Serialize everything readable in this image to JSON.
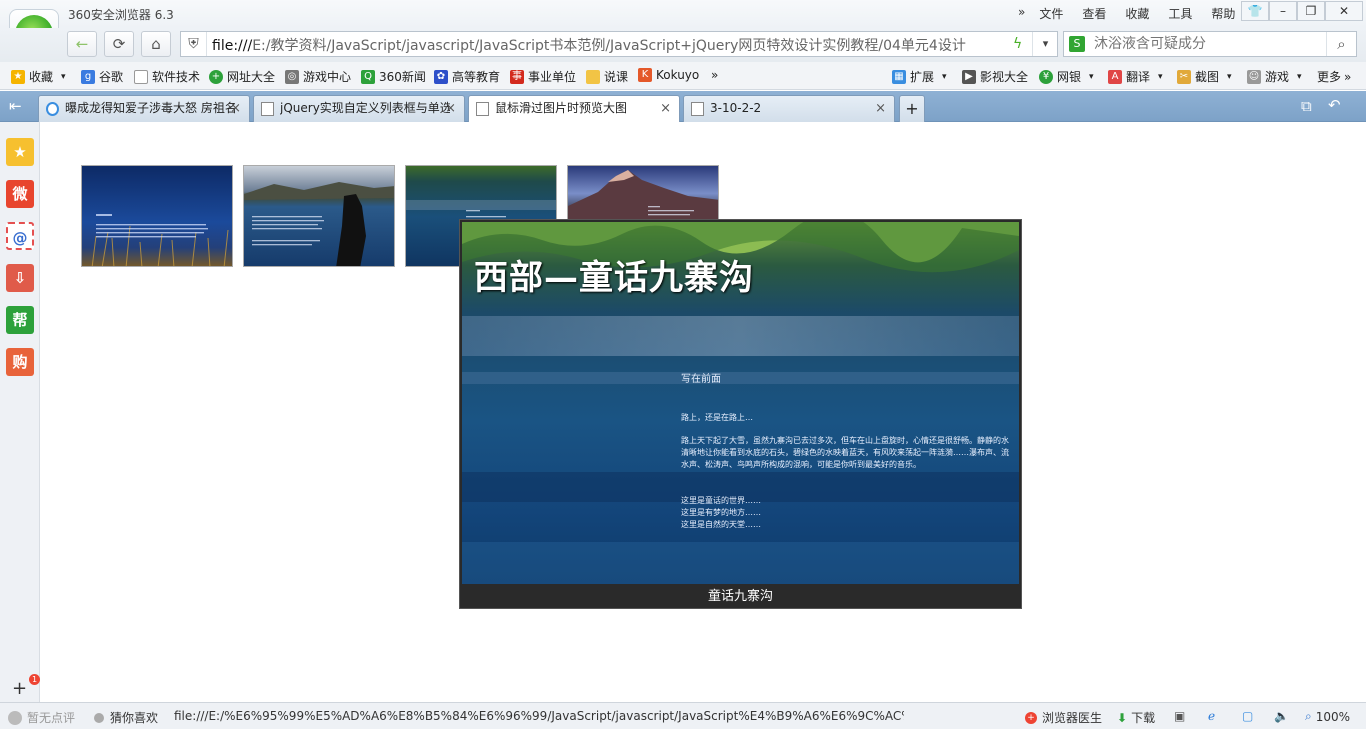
{
  "browser": {
    "app_title": "360安全浏览器 6.3",
    "logo_letter": "e",
    "menu": {
      "more": "»",
      "file": "文件",
      "view": "查看",
      "favorites": "收藏",
      "tools": "工具",
      "help": "帮助"
    },
    "window_buttons": {
      "skin": "👕",
      "minimize": "–",
      "restore": "❐",
      "close": "✕"
    }
  },
  "nav": {
    "back": "←",
    "refresh": "⟳",
    "home": "⌂",
    "address_prefix": "file:///",
    "address_rest": "E:/教学资料/JavaScript/javascript/JavaScript书本范例/JavaScript+jQuery网页特效设计实例教程/04单元4设计",
    "search_placeholder": "沐浴液含可疑成分",
    "search_engine": "S"
  },
  "bookmarks": {
    "items": [
      "收藏",
      "谷歌",
      "软件技术",
      "网址大全",
      "游戏中心",
      "360新闻",
      "高等教育",
      "事业单位",
      "说课",
      "Kokuyo"
    ],
    "more": "»",
    "right_items": [
      "扩展",
      "影视大全",
      "网银",
      "翻译",
      "截图",
      "游戏",
      "更多"
    ]
  },
  "tabs": [
    {
      "label": "曝成龙得知爱子涉毒大怒 房祖名"
    },
    {
      "label": "jQuery实现自定义列表框与单选"
    },
    {
      "label": "鼠标滑过图片时预览大图"
    },
    {
      "label": "3-10-2-2"
    }
  ],
  "tab_close": "×",
  "new_tab": "+",
  "sidebar": {
    "icons": [
      "star-icon",
      "weibo-icon",
      "mail-icon",
      "download-icon",
      "help-icon",
      "shop-icon"
    ],
    "labels": [
      "★",
      "微",
      "@",
      "⇩",
      "帮",
      "购"
    ],
    "add": "+",
    "badge": "1"
  },
  "gallery": {
    "thumbnails": [
      "thumb-blue-grass",
      "thumb-lake-stone",
      "thumb-jiuzhaigou",
      "thumb-mountain"
    ],
    "preview": {
      "headline": "西部—童话九寨沟",
      "article_heading": "写在前面",
      "lines": [
        "路上，还是在路上…",
        "路上天下起了大雪，虽然九寨沟已去过多次，但车在山上盘旋时，心情还是很舒畅。静静的水清晰地让你能看到水底的石头，碧绿色的水映着蓝天，有风吹来荡起一阵涟漪……瀑布声、流水声、松涛声、鸟鸣声所构成的混响，可能是你听到最美好的音乐。",
        "这里是童话的世界……",
        "这里是有梦的地方……",
        "这里是自然的天堂……"
      ],
      "caption": "童话九寨沟"
    }
  },
  "status": {
    "rating": "暂无点评",
    "guess": "猜你喜欢",
    "url": "file:///E:/%E6%95%99%E5%AD%A6%E8%B5%84%E6%96%99/JavaScript/javascript/JavaScript%E4%B9%A6%E6%9C%AC%E8%",
    "doctor": "浏览器医生",
    "download": "下载",
    "zoom": "100%"
  }
}
